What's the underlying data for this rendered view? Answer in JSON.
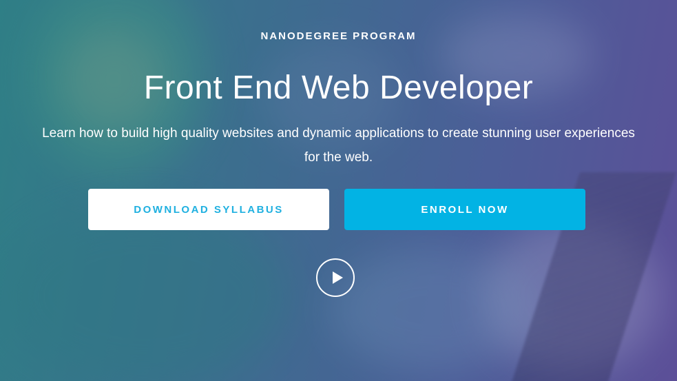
{
  "hero": {
    "eyebrow": "NANODEGREE PROGRAM",
    "title": "Front End Web Developer",
    "subtitle_line1": "Learn how to build high quality websites and dynamic applications to create stunning user experiences",
    "subtitle_line2": "for the web.",
    "download_label": "DOWNLOAD SYLLABUS",
    "enroll_label": "ENROLL NOW",
    "play_icon": "play-icon"
  },
  "colors": {
    "accent": "#02b3e4",
    "syllabus_text": "#1fb0e0",
    "white": "#ffffff"
  }
}
